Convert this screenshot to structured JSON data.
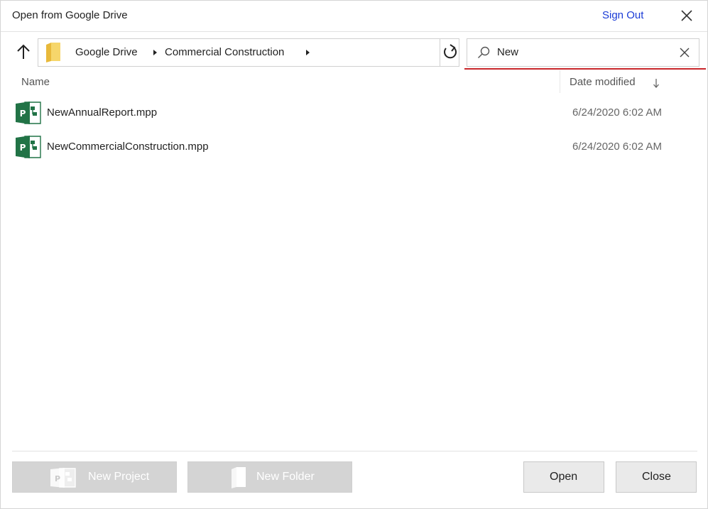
{
  "dialog": {
    "title": "Open from Google Drive",
    "sign_out_label": "Sign Out"
  },
  "breadcrumb": {
    "items": [
      "Google Drive",
      "Commercial Construction"
    ]
  },
  "search": {
    "value": "New"
  },
  "columns": {
    "name": "Name",
    "date_modified": "Date modified"
  },
  "files": [
    {
      "name": "NewAnnualReport.mpp",
      "date": "6/24/2020 6:02 AM",
      "icon": "project-file-icon"
    },
    {
      "name": "NewCommercialConstruction.mpp",
      "date": "6/24/2020 6:02 AM",
      "icon": "project-file-icon"
    }
  ],
  "footer": {
    "new_project_label": "New Project",
    "new_folder_label": "New Folder",
    "open_label": "Open",
    "close_label": "Close"
  },
  "colors": {
    "accent_underline": "#c8262b",
    "link": "#1a3bd6",
    "project_green": "#217346"
  }
}
